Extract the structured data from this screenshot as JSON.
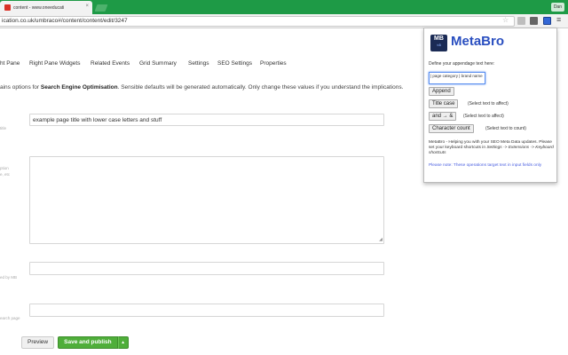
{
  "browser": {
    "tab_title": "content - www.oneeducati",
    "tab_close": "×",
    "user_label": "Dan",
    "url": "ication.co.uk/umbraco#/content/content/edit/3247"
  },
  "tabs": [
    {
      "label": "ht Pane"
    },
    {
      "label": "Right Pane Widgets"
    },
    {
      "label": "Related Events"
    },
    {
      "label": "Grid Summary"
    },
    {
      "label": "Settings"
    },
    {
      "label": "SEO Settings"
    },
    {
      "label": "Properties"
    }
  ],
  "description": {
    "prefix": "ains options for ",
    "bold": "Search Engine Optimisation",
    "suffix": ". Sensible defaults will be generated automatically. Only change these values if you understand the implications."
  },
  "labels": {
    "l1": "title",
    "l2": "ption",
    "l3": "e, etc",
    "l4": "ed by MB",
    "l5": "earch page"
  },
  "fields": {
    "title_value": "example page title with lower case letters and stuff",
    "description_value": "",
    "field3_value": "",
    "field4_value": ""
  },
  "buttons": {
    "preview": "Preview",
    "save_publish": "Save and publish",
    "caret": "▲"
  },
  "popup": {
    "logo_top": "MB",
    "logo_bottom": "≈3",
    "title": "MetaBro",
    "define_text": "Define your appendage text here:",
    "input_value": "| page category | brand name",
    "append_label": "Append",
    "titlecase_label": "Title case",
    "titlecase_note": "(Select text to affect)",
    "and_label": "and → &",
    "and_note": "(Select text to affect)",
    "count_label": "Character count",
    "count_note": "(Select text to count)",
    "info_text_1": "MetaBro - Helping you with your SEO Meta Data updates. Please set your keyboard shortcuts in ",
    "info_path": "Settings -> Extensions -> Keyboard shortcuts",
    "warning": "Please note: These operations target text in input fields only"
  }
}
